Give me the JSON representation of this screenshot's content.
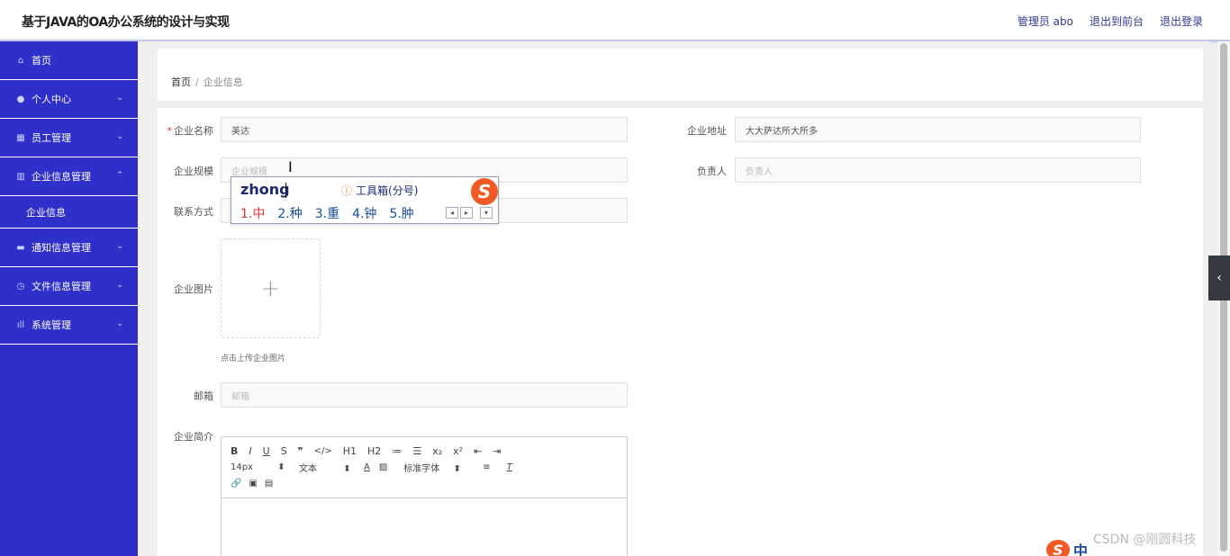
{
  "header": {
    "title": "基于JAVA的OA办公系统的设计与实现",
    "admin": "管理员 abo",
    "back_to_front": "退出到前台",
    "logout": "退出登录"
  },
  "sidebar": {
    "items": [
      {
        "label": "首页",
        "icon": "home-icon"
      },
      {
        "label": "个人中心",
        "icon": "user-icon"
      },
      {
        "label": "员工管理",
        "icon": "grid-icon"
      },
      {
        "label": "企业信息管理",
        "icon": "chart-icon"
      },
      {
        "label": "通知信息管理",
        "icon": "monitor-icon"
      },
      {
        "label": "文件信息管理",
        "icon": "clock-icon"
      },
      {
        "label": "系统管理",
        "icon": "bar-chart-icon"
      }
    ],
    "submenu": "企业信息"
  },
  "breadcrumb": {
    "home": "首页",
    "separator": "/",
    "current": "企业信息"
  },
  "form": {
    "name_label": "企业名称",
    "name_value": "美达",
    "address_label": "企业地址",
    "address_value": "大大萨达所大所多",
    "scale_label": "企业规模",
    "scale_placeholder": "企业规模",
    "manager_label": "负责人",
    "manager_placeholder": "负责人",
    "contact_label": "联系方式",
    "image_label": "企业图片",
    "upload_plus": "+",
    "upload_hint": "点击上传企业图片",
    "email_label": "邮箱",
    "email_placeholder": "邮箱",
    "intro_label": "企业简介"
  },
  "editor": {
    "row1": [
      "B",
      "I",
      "U",
      "S",
      "❞",
      "</>",
      "H1",
      "H2",
      "≔",
      "☰",
      "x₂",
      "x²",
      "⇤",
      "⇥"
    ],
    "font_size": "14px",
    "text_type": "文本",
    "font_name": "标准字体",
    "row3": [
      "🔗",
      "▣",
      "▤"
    ]
  },
  "ime": {
    "composition": "zhong",
    "toolbox": "工具箱(分号)",
    "candidates": [
      "1.中",
      "2.种",
      "3.重",
      "4.钟",
      "5.肿"
    ]
  },
  "watermark": "CSDN @刚圆科技",
  "tray": {
    "text": "中"
  }
}
